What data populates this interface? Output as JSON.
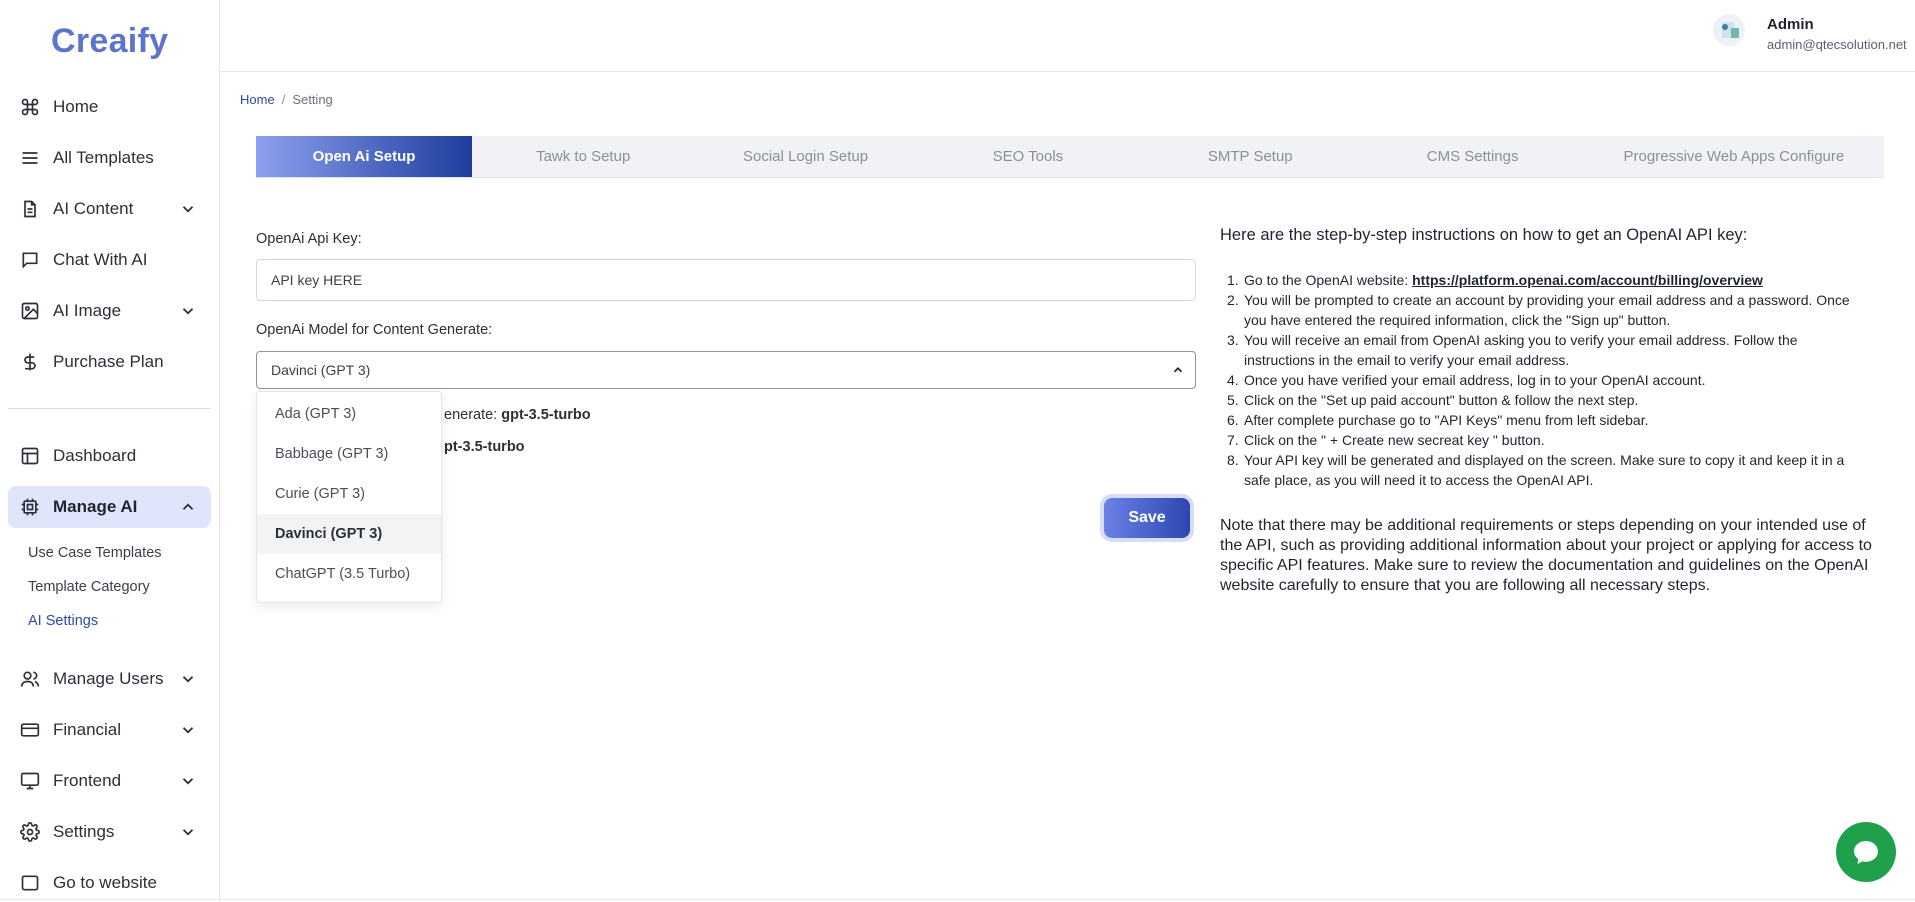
{
  "brand": {
    "logo_text": "Creaify"
  },
  "sidebar": {
    "items": [
      {
        "label": "Home",
        "icon": "command-icon"
      },
      {
        "label": "All Templates",
        "icon": "menu-lines-icon"
      },
      {
        "label": "AI Content",
        "icon": "document-icon",
        "has_children": true
      },
      {
        "label": "Chat With AI",
        "icon": "chat-bubble-icon"
      },
      {
        "label": "AI Image",
        "icon": "image-icon",
        "has_children": true
      },
      {
        "label": "Purchase Plan",
        "icon": "dollar-icon"
      },
      {
        "label": "Dashboard",
        "icon": "layout-icon"
      },
      {
        "label": "Manage AI",
        "icon": "chip-icon",
        "has_children": true,
        "expanded": true,
        "active": true
      },
      {
        "label": "Manage Users",
        "icon": "users-icon",
        "has_children": true
      },
      {
        "label": "Financial",
        "icon": "credit-card-icon",
        "has_children": true
      },
      {
        "label": "Frontend",
        "icon": "monitor-icon",
        "has_children": true
      },
      {
        "label": "Settings",
        "icon": "gear-icon",
        "has_children": true
      },
      {
        "label": "Go to website",
        "icon": "window-icon"
      }
    ],
    "manage_ai_sub": [
      {
        "label": "Use Case Templates"
      },
      {
        "label": "Template Category"
      },
      {
        "label": "AI Settings",
        "active": true
      }
    ]
  },
  "header": {
    "user_name": "Admin",
    "user_email": "admin@qtecsolution.net"
  },
  "breadcrumb": {
    "home": "Home",
    "sep": "/",
    "current": "Setting"
  },
  "tabs": [
    {
      "label": "Open Ai Setup",
      "active": true
    },
    {
      "label": "Tawk to Setup"
    },
    {
      "label": "Social Login Setup"
    },
    {
      "label": "SEO Tools"
    },
    {
      "label": "SMTP Setup"
    },
    {
      "label": "CMS Settings"
    },
    {
      "label": "Progressive Web Apps Configure"
    }
  ],
  "form": {
    "api_key_label": "OpenAi Api Key:",
    "api_key_value": "API key HERE",
    "model_label": "OpenAi Model for Content Generate:",
    "model_selected": "Davinci (GPT 3)",
    "model_options": [
      "Ada (GPT 3)",
      "Babbage (GPT 3)",
      "Curie (GPT 3)",
      "Davinci (GPT 3)",
      "ChatGPT (3.5 Turbo)"
    ],
    "info_line_1_prefix": "enerate: ",
    "info_line_1_value": "gpt-3.5-turbo",
    "info_line_2_value": "pt-3.5-turbo",
    "save_label": "Save"
  },
  "instructions": {
    "title": "Here are the step-by-step instructions on how to get an OpenAI API key:",
    "step1_prefix": "Go to the OpenAI website: ",
    "step1_link": "https://platform.openai.com/account/billing/overview",
    "steps": [
      "You will be prompted to create an account by providing your email address and a password. Once you have entered the required information, click the \"Sign up\" button.",
      "You will receive an email from OpenAI asking you to verify your email address. Follow the instructions in the email to verify your email address.",
      "Once you have verified your email address, log in to your OpenAI account.",
      "Click on the \"Set up paid account\" button & follow the next step.",
      "After complete purchase go to \"API Keys\" menu from left sidebar.",
      "Click on the \" + Create new secreat key \" button.",
      "Your API key will be generated and displayed on the screen. Make sure to copy it and keep it in a safe place, as you will need it to access the OpenAI API."
    ],
    "note": "Note that there may be additional requirements or steps depending on your intended use of the API, such as providing additional information about your project or applying for access to specific API features. Make sure to review the documentation and guidelines on the OpenAI website carefully to ensure that you are following all necessary steps."
  },
  "colors": {
    "accent": "#5d74c9",
    "active_bg": "#dfe6fb",
    "chat_green": "#1fa04a"
  }
}
